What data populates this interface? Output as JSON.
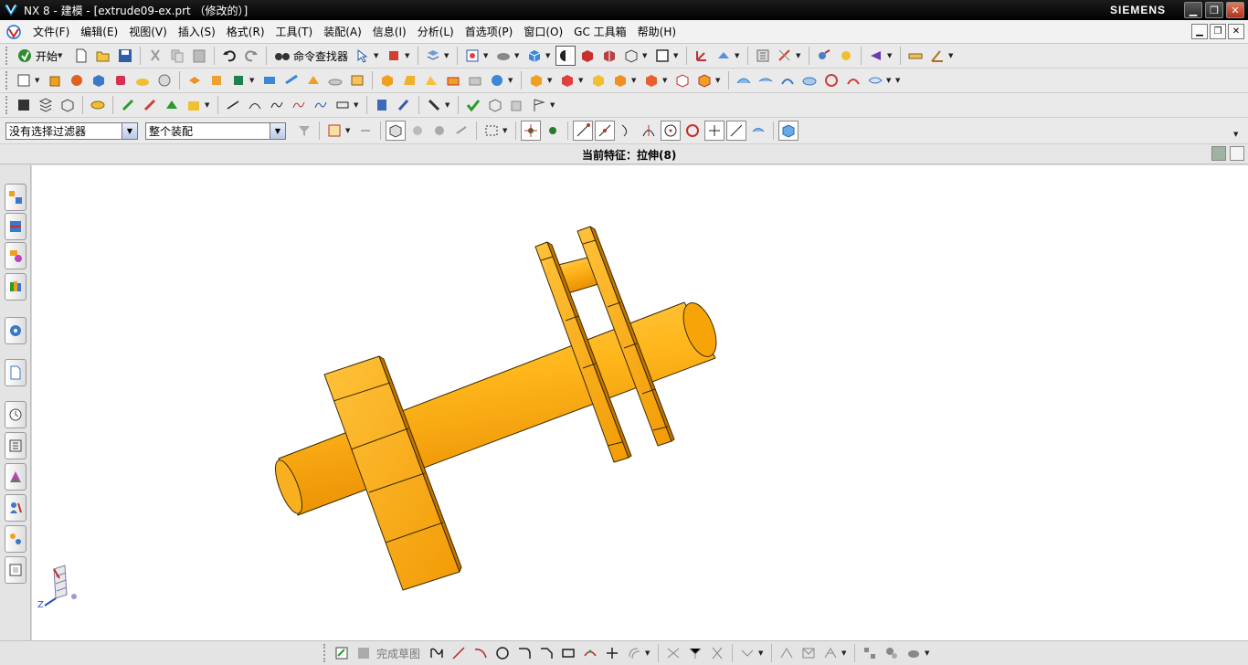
{
  "window": {
    "title": "NX 8 - 建模 - [extrude09-ex.prt （修改的）]",
    "brand": "SIEMENS"
  },
  "menu": {
    "items": [
      "文件(F)",
      "编辑(E)",
      "视图(V)",
      "插入(S)",
      "格式(R)",
      "工具(T)",
      "装配(A)",
      "信息(I)",
      "分析(L)",
      "首选项(P)",
      "窗口(O)",
      "GC 工具箱",
      "帮助(H)"
    ]
  },
  "toolbar1": {
    "start_label": "开始",
    "command_finder_label": "命令查找器"
  },
  "selection": {
    "filter_value": "没有选择过滤器",
    "scope_value": "整个装配"
  },
  "status": {
    "current_feature": "当前特征：拉伸(8)"
  },
  "sketch_toolbar": {
    "finish_label": "完成草图"
  },
  "triad": {
    "axis_z": "Z"
  },
  "colors": {
    "model_face": "#fdb515",
    "model_edge": "#3a2a00",
    "viewport_bg": "#ffffff"
  }
}
